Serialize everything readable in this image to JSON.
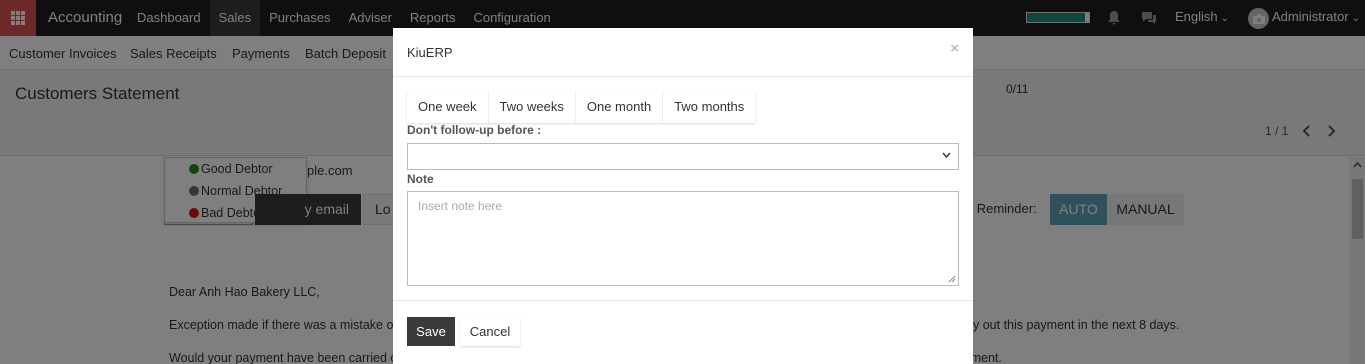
{
  "topbar": {
    "app_title": "Accounting",
    "menu": [
      "Dashboard",
      "Sales",
      "Purchases",
      "Adviser",
      "Reports",
      "Configuration"
    ],
    "active_menu": "Sales",
    "progress_fraction": 0.94,
    "language": "English",
    "user": "Administrator",
    "accent_color": "#d9534f"
  },
  "subnav": {
    "items": [
      "Customer Invoices",
      "Sales Receipts",
      "Payments",
      "Batch Deposit"
    ]
  },
  "control_panel": {
    "title": "Customers Statement",
    "counter": "0/11",
    "pager": "1 / 1"
  },
  "content": {
    "debtor_options": [
      {
        "label": "Good Debtor",
        "color": "#1a8f1a"
      },
      {
        "label": "Normal Debtor",
        "color": "#6d6d6d"
      },
      {
        "label": "Bad Debtor",
        "color": "#d61212"
      }
    ],
    "email_partial": "ple.com",
    "email_button": "y email",
    "log_button": "Lo",
    "next_reminder_label": "xt Reminder:",
    "auto_label": "AUTO",
    "manual_label": "MANUAL",
    "greeting": "Dear Anh Hao Bakery LLC,",
    "line1": "Exception made if there was a mistake of",
    "line1_right": "y out this payment in the next 8 days.",
    "line2": "Would your payment have been carried out after this mail was sent, please ignore this message. Do not hesitate to contact our accounting department."
  },
  "modal": {
    "title": "KiuERP",
    "close": "×",
    "quick_buttons": [
      "One week",
      "Two weeks",
      "One month",
      "Two months"
    ],
    "followup_label": "Don't follow-up before :",
    "note_label": "Note",
    "note_placeholder": "Insert note here",
    "save_label": "Save",
    "cancel_label": "Cancel"
  }
}
